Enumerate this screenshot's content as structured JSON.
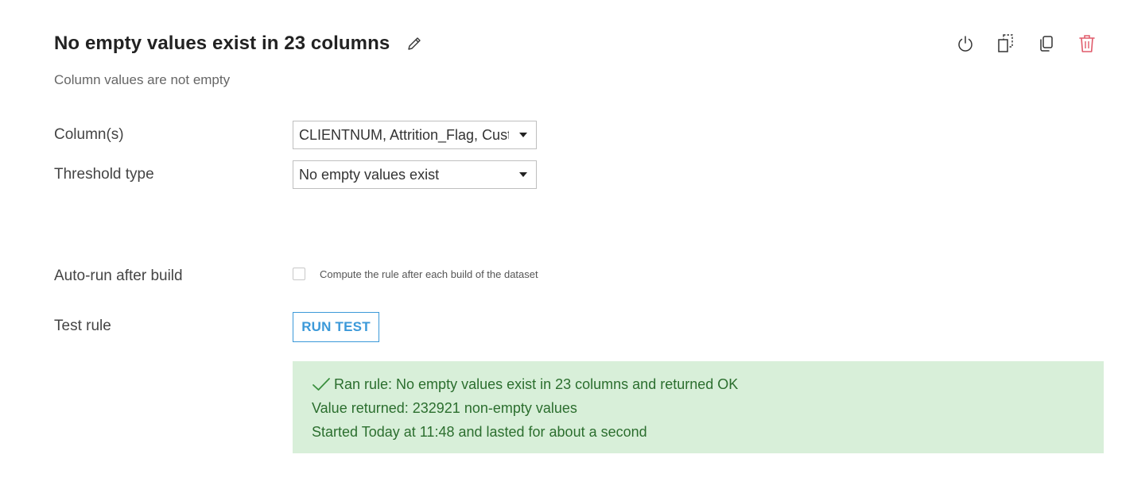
{
  "rule": {
    "title": "No empty values exist in 23 columns",
    "subtitle": "Column values are not empty"
  },
  "header_actions": [
    {
      "icon": "power-icon"
    },
    {
      "icon": "duplicate-dashed-icon"
    },
    {
      "icon": "copy-icon"
    },
    {
      "icon": "trash-icon"
    }
  ],
  "fields": {
    "columns": {
      "label": "Column(s)",
      "value": "CLIENTNUM, Attrition_Flag, Cust"
    },
    "threshold_type": {
      "label": "Threshold type",
      "value": "No empty values exist"
    },
    "auto_run": {
      "label": "Auto-run after build",
      "checkbox_label": "Compute the rule after each build of the dataset",
      "checked": false
    },
    "test_rule": {
      "label": "Test rule",
      "button_label": "RUN TEST"
    }
  },
  "result": {
    "line1": "Ran rule: No empty values exist in 23 columns and returned OK",
    "line2": "Value returned: 232921 non-empty values",
    "line3": "Started Today at 11:48 and lasted for about a second"
  },
  "colors": {
    "accent": "#3b99d9",
    "danger": "#e05a6a",
    "success_bg": "#d8efd9",
    "success_text": "#2b6e2e"
  }
}
